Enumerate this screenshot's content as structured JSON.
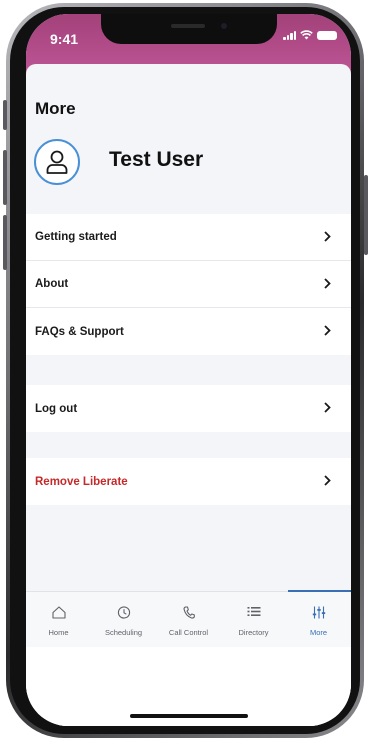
{
  "status_bar": {
    "time": "9:41"
  },
  "header": {
    "title": "More"
  },
  "profile": {
    "name": "Test User"
  },
  "menu_group_1": [
    {
      "label": "Getting started"
    },
    {
      "label": "About"
    },
    {
      "label": "FAQs & Support"
    }
  ],
  "menu_group_2": [
    {
      "label": "Log out"
    }
  ],
  "menu_group_3": [
    {
      "label": "Remove Liberate",
      "color": "#c42a2a"
    }
  ],
  "tabs": [
    {
      "label": "Home",
      "icon": "home-icon"
    },
    {
      "label": "Scheduling",
      "icon": "clock-icon"
    },
    {
      "label": "Call Control",
      "icon": "phone-icon"
    },
    {
      "label": "Directory",
      "icon": "list-icon"
    },
    {
      "label": "More",
      "icon": "sliders-icon",
      "active": true
    }
  ],
  "colors": {
    "status_bar_gradient_start": "#a2417a",
    "status_bar_gradient_end": "#c55a9c",
    "accent": "#3a6fb5",
    "avatar_ring": "#4a90d6",
    "danger": "#c42a2a"
  }
}
